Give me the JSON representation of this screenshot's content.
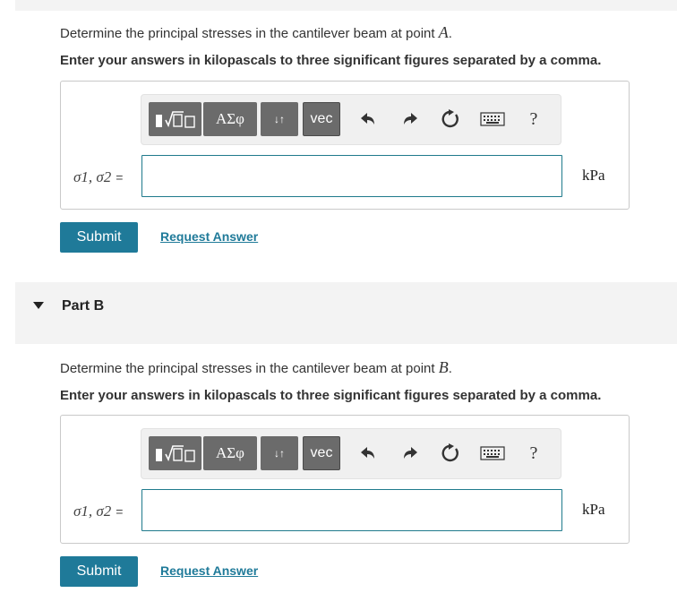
{
  "part_a": {
    "question_prefix": "Determine the principal stresses in the cantilever beam at point ",
    "point": "A",
    "question_suffix": ".",
    "instruction": "Enter your answers in kilopascals to three significant figures separated by a comma.",
    "answer_label": "σ1, σ2",
    "equals": "=",
    "input_value": "",
    "unit": "kPa",
    "submit_label": "Submit",
    "request_label": "Request Answer"
  },
  "part_b_header": {
    "title": "Part B"
  },
  "part_b": {
    "question_prefix": "Determine the principal stresses in the cantilever beam at point ",
    "point": "B",
    "question_suffix": ".",
    "instruction": "Enter your answers in kilopascals to three significant figures separated by a comma.",
    "answer_label": "σ1, σ2",
    "equals": "=",
    "input_value": "",
    "unit": "kPa",
    "submit_label": "Submit",
    "request_label": "Request Answer"
  },
  "toolbar": {
    "greek_label": "ΑΣφ",
    "vec_label": "vec",
    "arrows_label": "↓↑",
    "help_label": "?",
    "icons": [
      "templates-icon",
      "greek-symbols-icon",
      "subscript-superscript-icon",
      "vector-icon",
      "undo-icon",
      "redo-icon",
      "reset-icon",
      "keyboard-icon",
      "help-icon"
    ]
  },
  "colors": {
    "accent": "#1f7a99",
    "toolbar_button": "#6b6b6b",
    "band": "#f3f3f3"
  }
}
